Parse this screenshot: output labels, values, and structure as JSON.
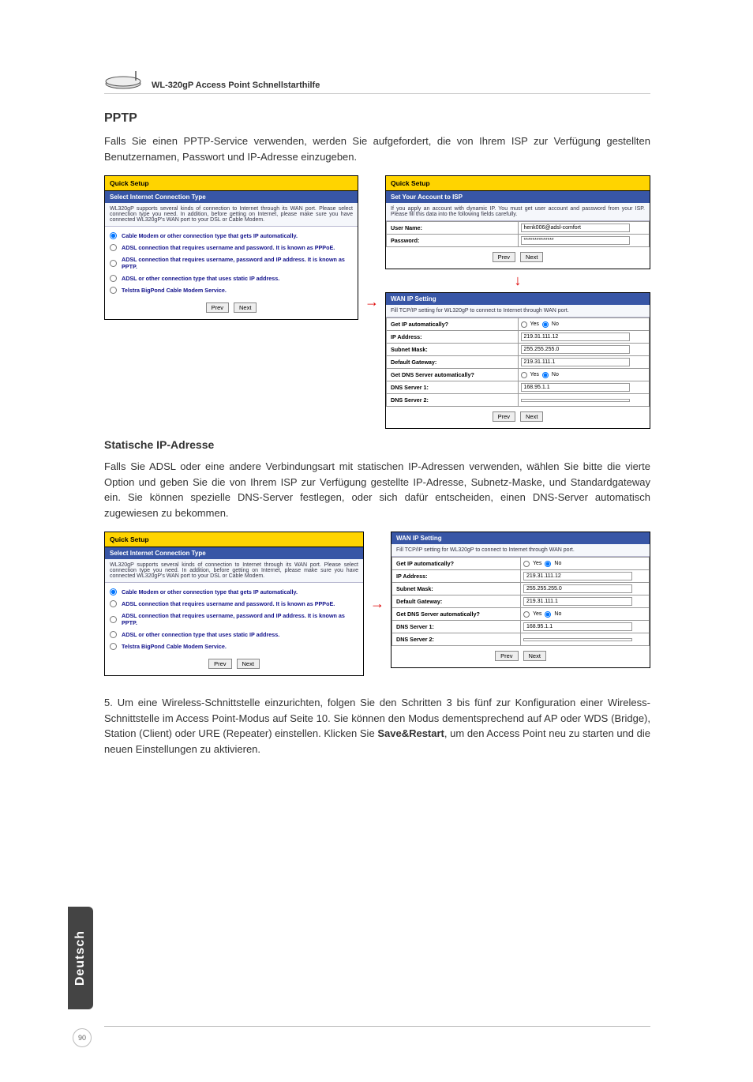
{
  "header": {
    "title": "WL-320gP Access Point Schnellstarthilfe"
  },
  "section1": {
    "heading": "PPTP",
    "body": "Falls Sie einen PPTP-Service verwenden, werden Sie aufgefordert, die von Ihrem ISP zur Verfügung gestellten Benutzernamen, Passwort und IP-Adresse einzugeben."
  },
  "left_panel": {
    "title": "Quick Setup",
    "subtitle": "Select Internet Connection Type",
    "desc": "WL320gP supports several kinds of connection to Internet through its WAN port. Please select connection type you need. In addition, before getting on Internet, please make sure you have connected WL320gP's WAN port to your DSL or Cable Modem.",
    "opts": [
      "Cable Modem or other connection type that gets IP automatically.",
      "ADSL connection that requires username and password. It is known as PPPoE.",
      "ADSL connection that requires username, password and IP address. It is known as PPTP.",
      "ADSL or other connection type that uses static IP address.",
      "Telstra BigPond Cable Modem Service."
    ],
    "prev": "Prev",
    "next": "Next"
  },
  "account_panel": {
    "title": "Quick Setup",
    "subtitle": "Set Your Account to ISP",
    "desc": "If you apply an account with dynamic IP. You must get user account and password from your ISP. Please fill this data into the following fields carefully.",
    "user_label": "User Name:",
    "user_val": "henk006@adsl-comfort",
    "pass_label": "Password:",
    "pass_val": "**************",
    "prev": "Prev",
    "next": "Next"
  },
  "wan_panel": {
    "title": "WAN IP Setting",
    "desc": "Fill TCP/IP setting for WL320gP to connect to Internet through WAN port.",
    "rows": {
      "get_ip": "Get IP automatically?",
      "ip": "IP Address:",
      "mask": "Subnet Mask:",
      "gw": "Default Gateway:",
      "get_dns": "Get DNS Server automatically?",
      "dns1": "DNS Server 1:",
      "dns2": "DNS Server 2:"
    },
    "vals": {
      "ip": "219.31.111.12",
      "mask": "255.255.255.0",
      "gw": "219.31.111.1",
      "dns1": "168.95.1.1",
      "dns2": ""
    },
    "yes": "Yes",
    "no": "No",
    "prev": "Prev",
    "next": "Next"
  },
  "section2": {
    "heading": "Statische IP-Adresse",
    "body": "Falls Sie ADSL oder eine andere Verbindungsart mit statischen IP-Adressen verwenden, wählen Sie bitte die vierte Option und geben Sie die von Ihrem ISP zur Verfügung gestellte IP-Adresse, Subnetz-Maske, und Standardgateway ein. Sie können spezielle DNS-Server festlegen, oder sich dafür entscheiden, einen DNS-Server automatisch zugewiesen zu bekommen."
  },
  "step5": "5. Um eine Wireless-Schnittstelle einzurichten, folgen Sie den Schritten 3 bis fünf zur Konfiguration einer Wireless-Schnittstelle im Access Point-Modus auf Seite 10. Sie können den Modus dementsprechend auf AP oder WDS (Bridge), Station (Client) oder URE (Repeater) einstellen. Klicken Sie <b>Save&Restart</b>, um den Access Point neu zu starten und die neuen Einstellungen zu aktivieren.",
  "tab": "Deutsch",
  "pagenum": "90",
  "chart_data": {
    "type": "table",
    "title": "WAN IP Setting",
    "rows": [
      {
        "field": "Get IP automatically?",
        "value": "No"
      },
      {
        "field": "IP Address",
        "value": "219.31.111.12"
      },
      {
        "field": "Subnet Mask",
        "value": "255.255.255.0"
      },
      {
        "field": "Default Gateway",
        "value": "219.31.111.1"
      },
      {
        "field": "Get DNS Server automatically?",
        "value": "No"
      },
      {
        "field": "DNS Server 1",
        "value": "168.95.1.1"
      },
      {
        "field": "DNS Server 2",
        "value": ""
      }
    ]
  }
}
